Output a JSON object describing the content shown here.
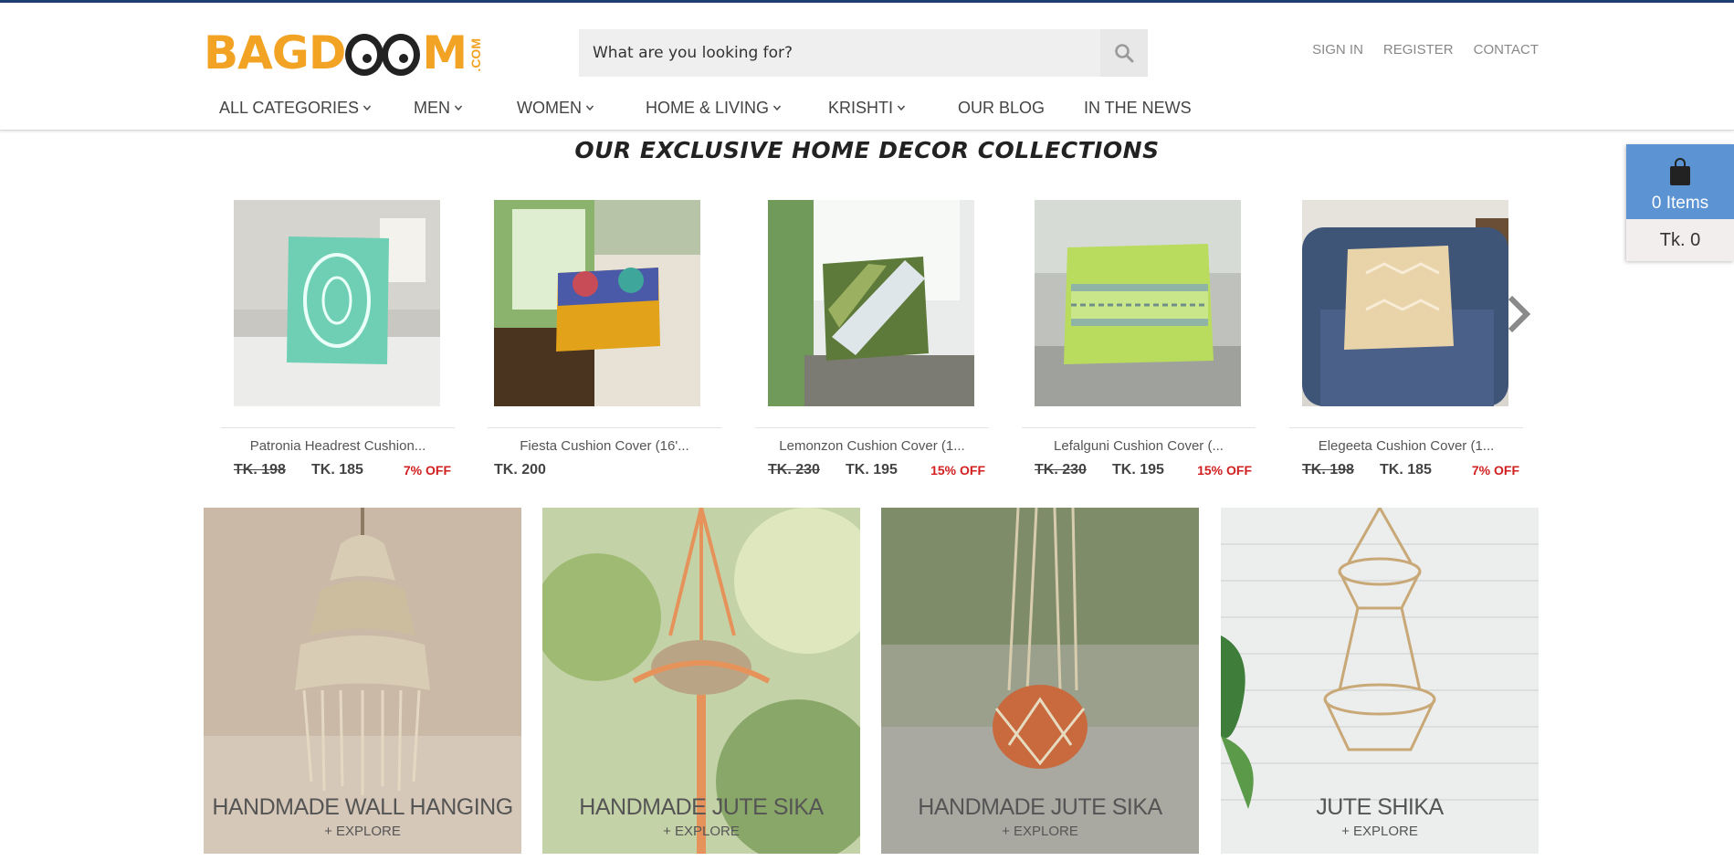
{
  "brand": {
    "logo_prefix": "BAGD",
    "logo_suffix": "M",
    "logo_com": ".COM",
    "orange": "#f2a324"
  },
  "search": {
    "placeholder": "What are you looking for?",
    "icon": "search-icon"
  },
  "top_links": [
    "SIGN IN",
    "REGISTER",
    "CONTACT"
  ],
  "nav": [
    {
      "label": "ALL CATEGORIES",
      "dropdown": true
    },
    {
      "label": "MEN",
      "dropdown": true
    },
    {
      "label": "WOMEN",
      "dropdown": true
    },
    {
      "label": "HOME & LIVING",
      "dropdown": true
    },
    {
      "label": "KRISHTI",
      "dropdown": true
    },
    {
      "label": "OUR BLOG",
      "dropdown": false
    },
    {
      "label": "IN THE NEWS",
      "dropdown": false
    }
  ],
  "collection_title": "OUR EXCLUSIVE HOME DECOR COLLECTIONS",
  "products": [
    {
      "name": "Patronia Headrest Cushion...",
      "old_price": "TK. 198",
      "price": "TK. 185",
      "discount": "7% OFF"
    },
    {
      "name": "Fiesta Cushion Cover (16'...",
      "old_price": "",
      "price": "TK. 200",
      "discount": ""
    },
    {
      "name": "Lemonzon Cushion Cover (1...",
      "old_price": "TK. 230",
      "price": "TK. 195",
      "discount": "15% OFF"
    },
    {
      "name": "Lefalguni Cushion Cover (...",
      "old_price": "TK. 230",
      "price": "TK. 195",
      "discount": "15% OFF"
    },
    {
      "name": "Elegeeta Cushion Cover (1...",
      "old_price": "TK. 198",
      "price": "TK. 185",
      "discount": "7% OFF"
    }
  ],
  "cart": {
    "items": "0 Items",
    "total": "Tk. 0",
    "accent": "#5b93d3"
  },
  "banners": [
    {
      "title": "HANDMADE WALL HANGING",
      "cta": "+ EXPLORE"
    },
    {
      "title": "HANDMADE JUTE SIKA",
      "cta": "+ EXPLORE"
    },
    {
      "title": "HANDMADE JUTE SIKA",
      "cta": "+ EXPLORE"
    },
    {
      "title": "JUTE SHIKA",
      "cta": "+ EXPLORE"
    }
  ],
  "colors": {
    "discount": "#d11f1f",
    "header_line": "#1f3f73"
  }
}
